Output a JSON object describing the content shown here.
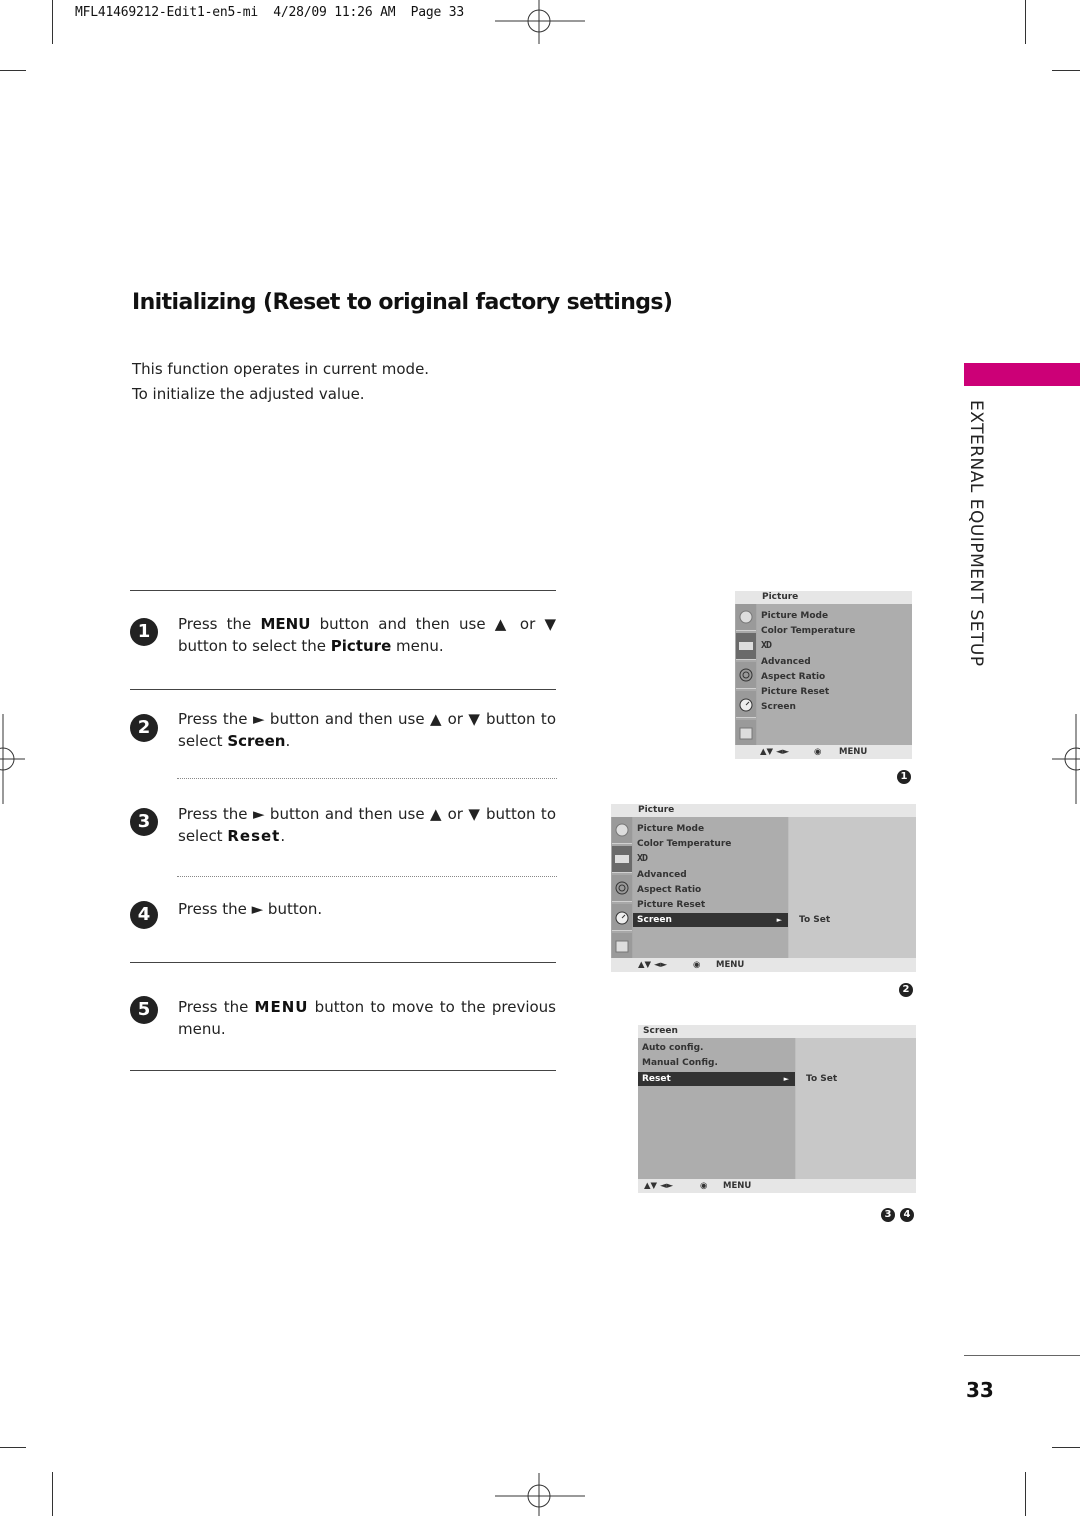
{
  "print_slug": "MFL41469212-Edit1-en5-mi  4/28/09 11:26 AM  Page 33",
  "title": "Initializing (Reset to original factory settings)",
  "intro": [
    "This function operates in current mode.",
    "To initialize the adjusted value."
  ],
  "steps": [
    {
      "num": "1",
      "parts": [
        "Press the ",
        "MENU",
        " button and then use ▲ or ▼ button to select the ",
        "Picture",
        " menu."
      ]
    },
    {
      "num": "2",
      "parts": [
        "Press the ► button and then use ▲ or ▼ button to select ",
        "Screen",
        "."
      ]
    },
    {
      "num": "3",
      "parts": [
        "Press the ► button and then use ▲ or ▼ button to select ",
        "Reset",
        "."
      ]
    },
    {
      "num": "4",
      "parts": [
        "Press the ► button."
      ]
    },
    {
      "num": "5",
      "parts": [
        "Press the ",
        "MENU",
        " button to move to the previous menu."
      ]
    }
  ],
  "section_tab": {
    "label": "EXTERNAL EQUIPMENT SETUP",
    "color": "#cc0077"
  },
  "page_number": "33",
  "osd1": {
    "title": "Picture",
    "items": [
      "Picture Mode",
      "Color Temperature",
      "XD",
      "Advanced",
      "Aspect Ratio",
      "Picture Reset",
      "Screen"
    ],
    "footer": {
      "nav": "▲▼  ◄►",
      "ok_icon": "◉",
      "menu": "MENU"
    },
    "badge": "1"
  },
  "osd2": {
    "title": "Picture",
    "items": [
      "Picture Mode",
      "Color Temperature",
      "XD",
      "Advanced",
      "Aspect Ratio",
      "Picture Reset",
      "Screen"
    ],
    "selected": "Screen",
    "right_value": "To Set",
    "footer": {
      "nav": "▲▼  ◄►",
      "ok_icon": "◉",
      "menu": "MENU"
    },
    "badge": "2"
  },
  "osd3": {
    "title": "Screen",
    "items": [
      "Auto config.",
      "Manual Config.",
      "Reset"
    ],
    "selected": "Reset",
    "right_value": "To Set",
    "footer": {
      "nav": "▲▼  ◄►",
      "ok_icon": "◉",
      "menu": "MENU"
    },
    "badges": [
      "3",
      "4"
    ]
  },
  "icons": [
    "picture-icon",
    "screen-tv-icon",
    "audio-icon",
    "time-icon",
    "option-icon"
  ]
}
